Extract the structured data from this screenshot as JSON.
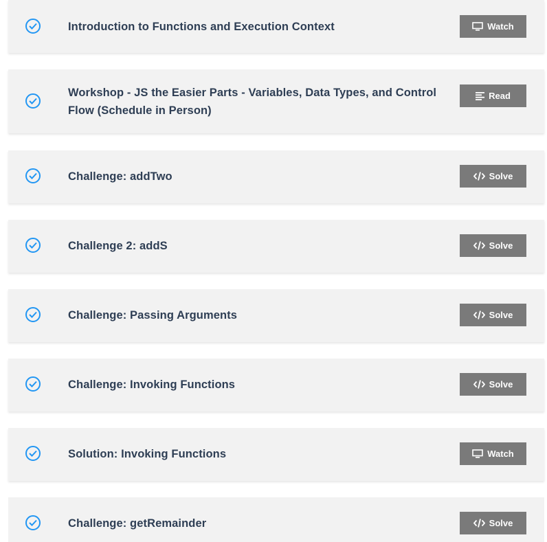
{
  "lessons": [
    {
      "title": "Introduction to Functions and Execution Context",
      "action": "Watch",
      "icon": "monitor-icon",
      "completed": true
    },
    {
      "title": "Workshop - JS the Easier Parts - Variables, Data Types, and Control Flow (Schedule in Person)",
      "action": "Read",
      "icon": "text-lines-icon",
      "completed": true
    },
    {
      "title": "Challenge: addTwo",
      "action": "Solve",
      "icon": "code-icon",
      "completed": true
    },
    {
      "title": "Challenge 2: addS",
      "action": "Solve",
      "icon": "code-icon",
      "completed": true
    },
    {
      "title": "Challenge: Passing Arguments",
      "action": "Solve",
      "icon": "code-icon",
      "completed": true
    },
    {
      "title": "Challenge: Invoking Functions",
      "action": "Solve",
      "icon": "code-icon",
      "completed": true
    },
    {
      "title": "Solution: Invoking Functions",
      "action": "Watch",
      "icon": "monitor-icon",
      "completed": true
    },
    {
      "title": "Challenge: getRemainder",
      "action": "Solve",
      "icon": "code-icon",
      "completed": true
    }
  ],
  "colors": {
    "check": "#2196f3",
    "title": "#2e3e54",
    "card": "#f2f2f2",
    "button": "#7a7a7a"
  }
}
